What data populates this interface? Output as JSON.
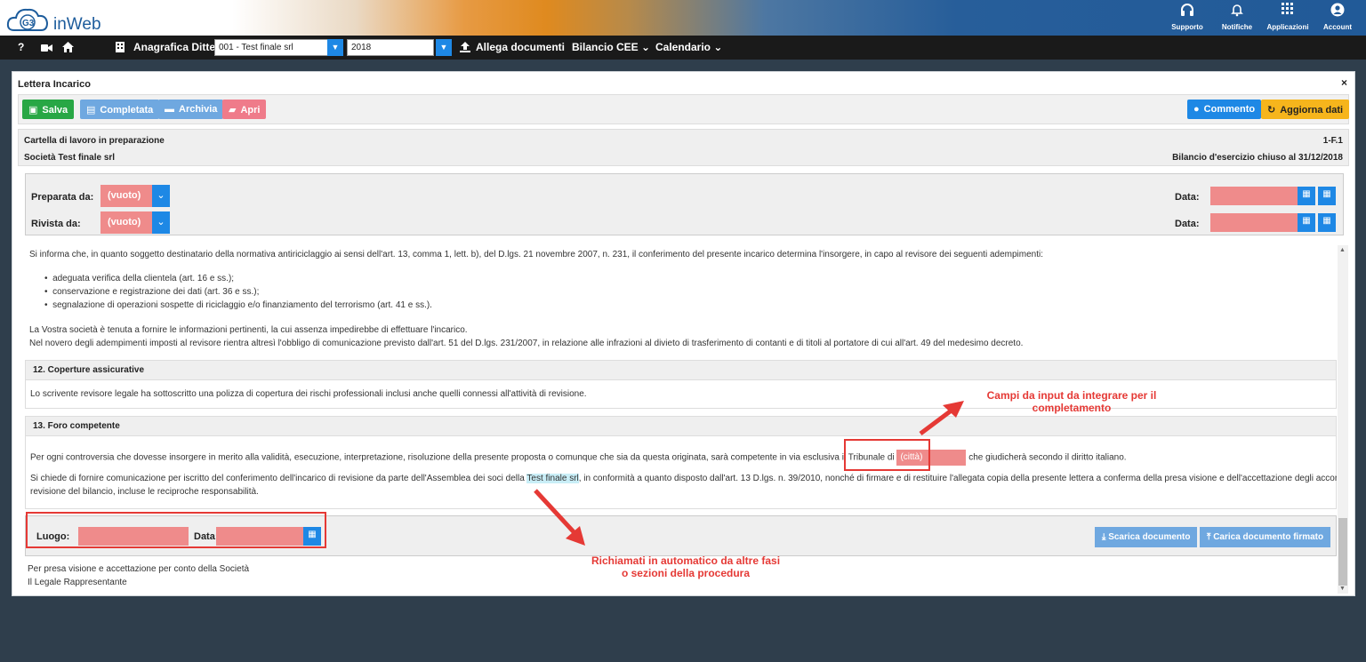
{
  "app": {
    "name": "inWeb",
    "logo_text": "G3"
  },
  "topbar": {
    "items": [
      {
        "label": "Supporto",
        "icon": "headset-icon"
      },
      {
        "label": "Notifiche",
        "icon": "bell-icon"
      },
      {
        "label": "Applicazioni",
        "icon": "grid-icon"
      },
      {
        "label": "Account",
        "icon": "user-icon"
      }
    ]
  },
  "navbar": {
    "help": "?",
    "anagrafica": "Anagrafica Ditte",
    "company_select": "001 - Test finale srl",
    "year_select": "2018",
    "allega": "Allega documenti",
    "bilancio": "Bilancio CEE",
    "calendario": "Calendario"
  },
  "panel": {
    "title": "Lettera Incarico",
    "close": "×",
    "buttons": {
      "salva": "Salva",
      "completata": "Completata",
      "archivia": "Archivia",
      "apri": "Apri",
      "commento": "Commento",
      "aggiorna": "Aggiorna dati"
    },
    "info": {
      "status": "Cartella di lavoro in preparazione",
      "code": "1-F.1",
      "company": "Società Test finale srl",
      "bilancio": "Bilancio d'esercizio chiuso al 31/12/2018"
    },
    "signatures": {
      "prepared_label": "Preparata da:",
      "prepared_value": "(vuoto)",
      "reviewed_label": "Rivista da:",
      "reviewed_value": "(vuoto)",
      "date_label": "Data:"
    }
  },
  "content": {
    "intro": "Si informa che, in quanto soggetto destinatario della normativa antiriciclaggio ai sensi dell'art. 13, comma 1, lett. b), del D.lgs. 21 novembre 2007, n. 231, il conferimento del presente incarico determina l'insorgere, in capo al revisore dei seguenti adempimenti:",
    "bullets": [
      "adeguata verifica della clientela (art. 16 e ss.);",
      "conservazione e registrazione dei dati (art. 36 e ss.);",
      "segnalazione di operazioni sospette di riciclaggio e/o finanziamento del terrorismo (art. 41 e ss.)."
    ],
    "para1": "La Vostra società è tenuta a fornire le informazioni pertinenti, la cui assenza impedirebbe di effettuare l'incarico.",
    "para2": "Nel novero degli adempimenti imposti al revisore rientra altresì l'obbligo di comunicazione previsto dall'art. 51 del D.lgs. 231/2007, in relazione alle infrazioni al divieto di trasferimento di contanti e di titoli al portatore di cui all'art. 49 del medesimo decreto.",
    "sec12_title": "12. Coperture assicurative",
    "sec12_body": "Lo scrivente revisore legale ha sottoscritto una polizza di copertura dei rischi professionali inclusi anche quelli connessi all'attività di revisione.",
    "sec13_title": "13. Foro competente",
    "sec13_p1a": "Per ogni controversia che dovesse insorgere in merito alla validità, esecuzione, interpretazione, risoluzione della presente proposta o comunque che sia da questa originata, sarà competente in via esclusiva il Tribunale di",
    "sec13_city": "(città)",
    "sec13_p1b": "che giudicherà secondo il diritto italiano.",
    "sec13_p2a": "Si chiede di fornire comunicazione per iscritto del conferimento dell'incarico di revisione da parte dell'Assemblea dei soci della",
    "sec13_company": "Test finale srl",
    "sec13_p2b": ", in conformità a quanto disposto dall'art. 13 D.lgs. n. 39/2010, nonché di firmare e di restituire l'allegata copia della presente lettera a conferma della presa visione e dell'accettazione degli accordi per la",
    "sec13_p2c": "revisione del bilancio, incluse le reciproche responsabilità.",
    "luogo_label": "Luogo:",
    "data_label": "Data:",
    "scarica": "Scarica documento",
    "carica": "Carica documento firmato",
    "presa": "Per presa visione e accettazione per conto della Società",
    "legale": "Il Legale Rappresentante"
  },
  "annotations": {
    "a1_line1": "Campi da input da integrare per il",
    "a1_line2": "completamento",
    "a2_line1": "Richiamati in automatico da altre fasi",
    "a2_line2": "o sezioni della procedura"
  },
  "colors": {
    "red_annot": "#e53935",
    "pink_field": "#ef8b8b",
    "primary": "#1e88e5"
  }
}
